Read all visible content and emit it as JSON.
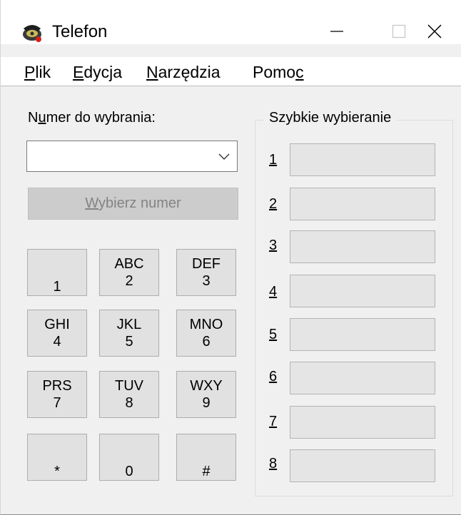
{
  "window": {
    "title": "Telefon",
    "icon": "telephone-icon",
    "controls": [
      "minimize-icon",
      "maximize-icon",
      "close-icon"
    ]
  },
  "menu": [
    {
      "accel": "P",
      "rest": "lik"
    },
    {
      "accel": "E",
      "rest": "dycja"
    },
    {
      "accel": "N",
      "rest": "arzędzia"
    },
    {
      "pre": "Pomo",
      "accel": "c",
      "rest": ""
    }
  ],
  "dialer": {
    "label_pre": "N",
    "label_accel": "u",
    "label_rest": "mer do wybrania:",
    "number_value": "",
    "dial_accel": "W",
    "dial_rest": "ybierz numer",
    "dial_enabled": false
  },
  "keypad": [
    {
      "letters": "",
      "digit": "1"
    },
    {
      "letters": "ABC",
      "digit": "2"
    },
    {
      "letters": "DEF",
      "digit": "3"
    },
    {
      "letters": "GHI",
      "digit": "4"
    },
    {
      "letters": "JKL",
      "digit": "5"
    },
    {
      "letters": "MNO",
      "digit": "6"
    },
    {
      "letters": "PRS",
      "digit": "7"
    },
    {
      "letters": "TUV",
      "digit": "8"
    },
    {
      "letters": "WXY",
      "digit": "9"
    },
    {
      "letters": "",
      "digit": "*"
    },
    {
      "letters": "",
      "digit": "0"
    },
    {
      "letters": "",
      "digit": "#"
    }
  ],
  "speed_dial": {
    "title": "Szybkie wybieranie",
    "entries": [
      {
        "number": "1",
        "value": ""
      },
      {
        "number": "2",
        "value": ""
      },
      {
        "number": "3",
        "value": ""
      },
      {
        "number": "4",
        "value": ""
      },
      {
        "number": "5",
        "value": ""
      },
      {
        "number": "6",
        "value": ""
      },
      {
        "number": "7",
        "value": ""
      },
      {
        "number": "8",
        "value": ""
      }
    ]
  }
}
